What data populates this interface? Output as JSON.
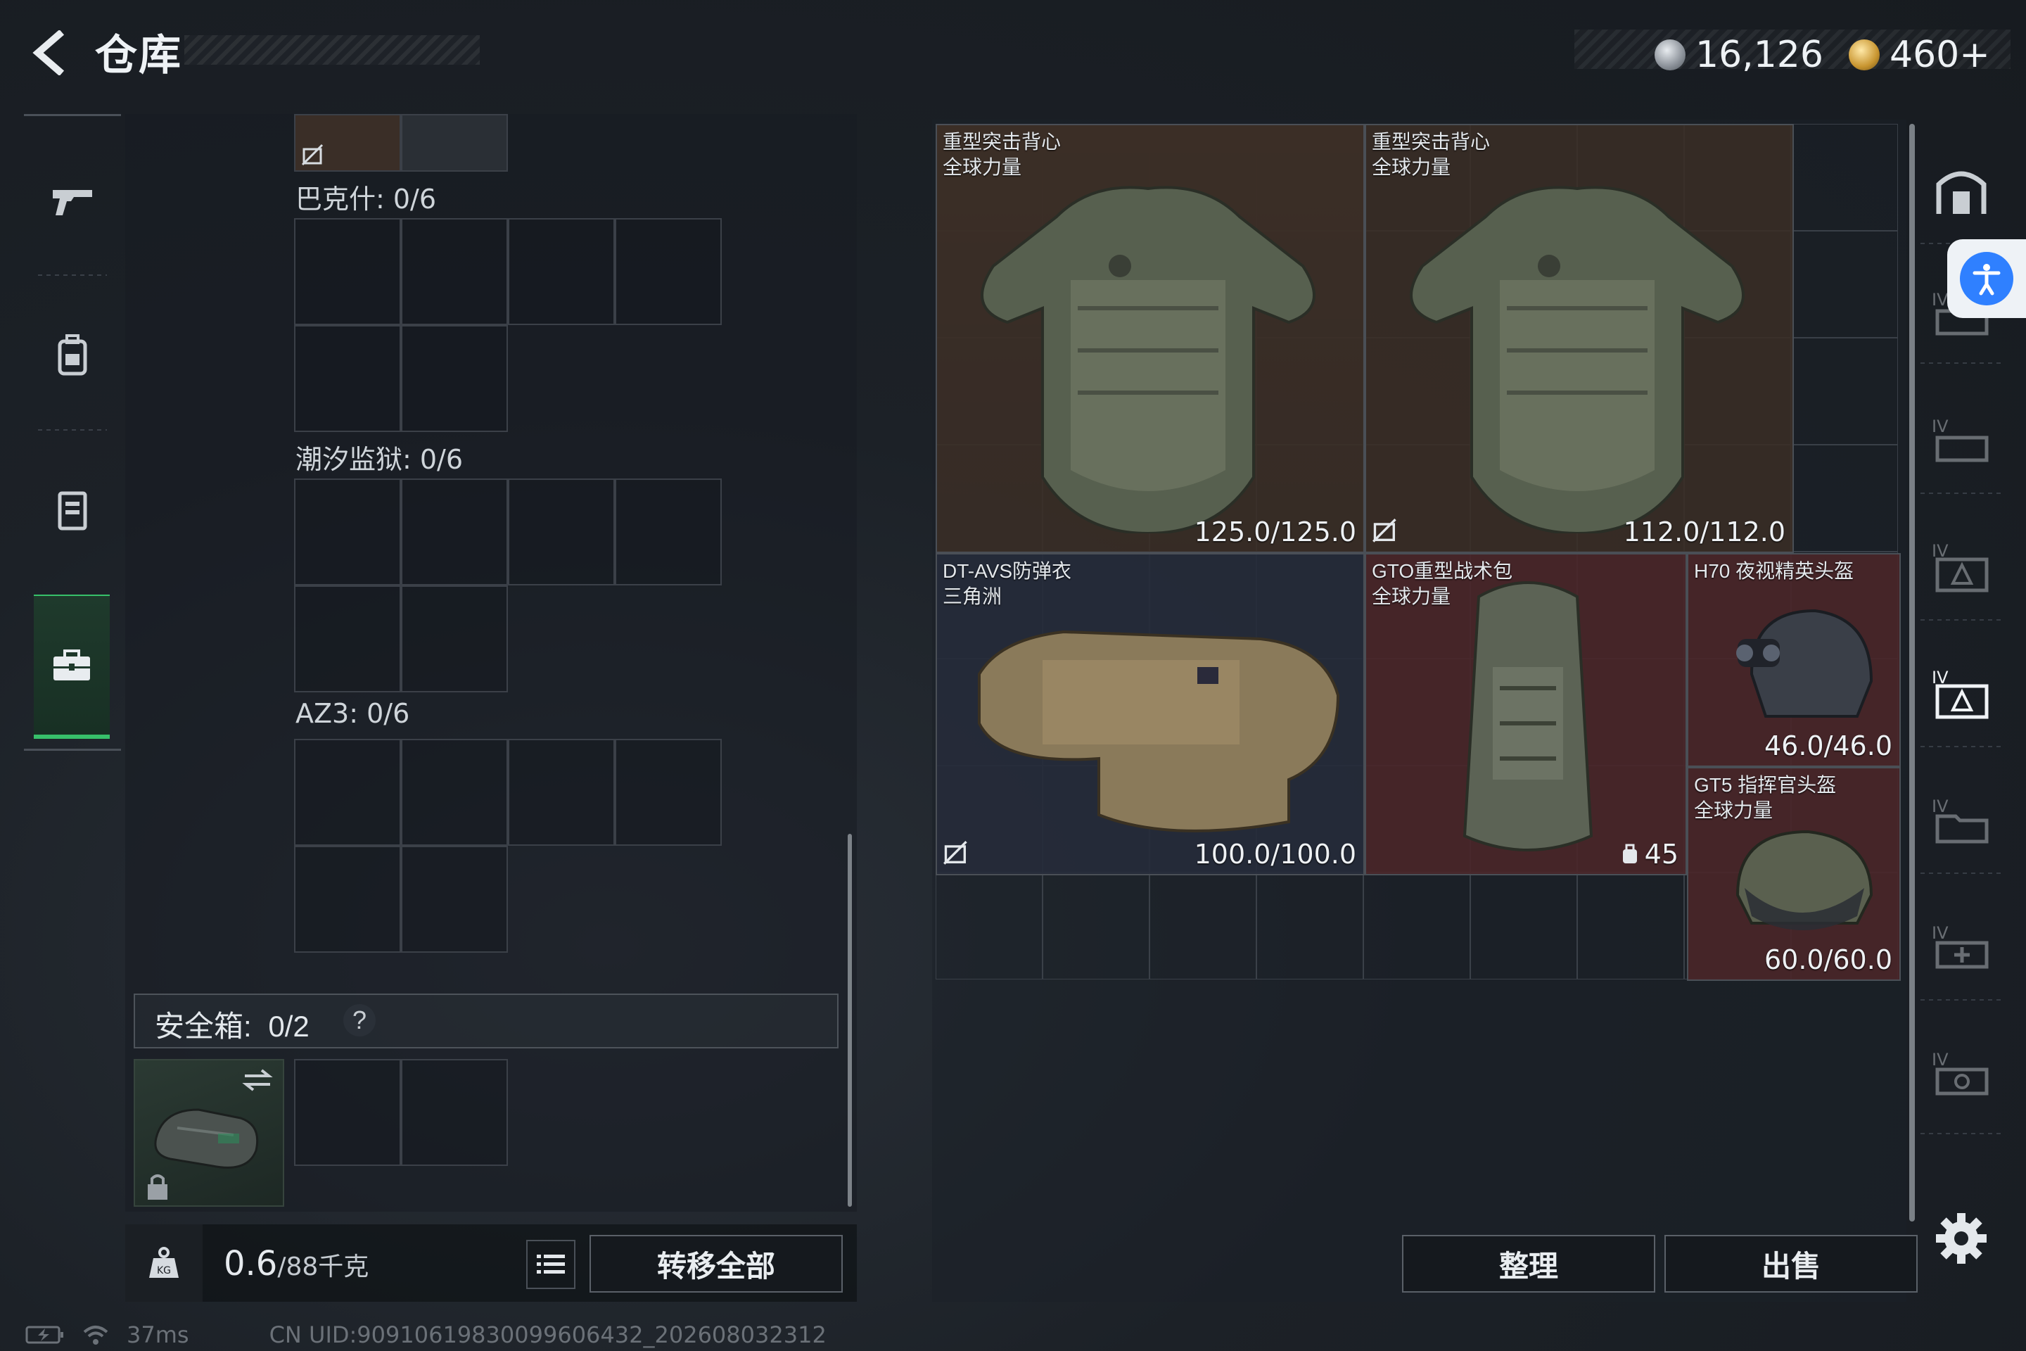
{
  "header": {
    "title": "仓库",
    "currency1": "16,126",
    "currency2": "460+"
  },
  "left_nav": {
    "items": [
      "gun-icon",
      "backpack-icon",
      "vest-icon",
      "case-icon"
    ],
    "active": 3
  },
  "left_panel": {
    "sections": [
      {
        "label": "巴克什: 0/6"
      },
      {
        "label": "潮汐监狱: 0/6"
      },
      {
        "label": "AZ3: 0/6"
      }
    ],
    "safe_box": {
      "label": "安全箱:",
      "value": "0/2",
      "help": "?"
    }
  },
  "bottom_left": {
    "weight": "0.6",
    "weight_max": "/88千克",
    "transfer_all": "转移全部"
  },
  "items": [
    {
      "name1": "重型突击背心",
      "name2": "全球力量",
      "value": "125.0/125.0"
    },
    {
      "name1": "重型突击背心",
      "name2": "全球力量",
      "value": "112.0/112.0"
    },
    {
      "name1": "DT-AVS防弹衣",
      "name2": "三角洲",
      "value": "100.0/100.0"
    },
    {
      "name1": "GTO重型战术包",
      "name2": "全球力量",
      "value": "45"
    },
    {
      "name1": "H70 夜视精英头盔",
      "name2": "",
      "value": "46.0/46.0"
    },
    {
      "name1": "GT5 指挥官头盔",
      "name2": "全球力量",
      "value": "60.0/60.0"
    }
  ],
  "actions": {
    "sort": "整理",
    "sell": "出售"
  },
  "status_bar": {
    "ping": "37ms",
    "uid": "CN UID:9091061983009960​6432_202608032312"
  },
  "colors": {
    "accent_green": "#37c06a",
    "item_brown": "#3b2e26",
    "item_red": "#4a2629",
    "item_blue": "#262b3a"
  }
}
